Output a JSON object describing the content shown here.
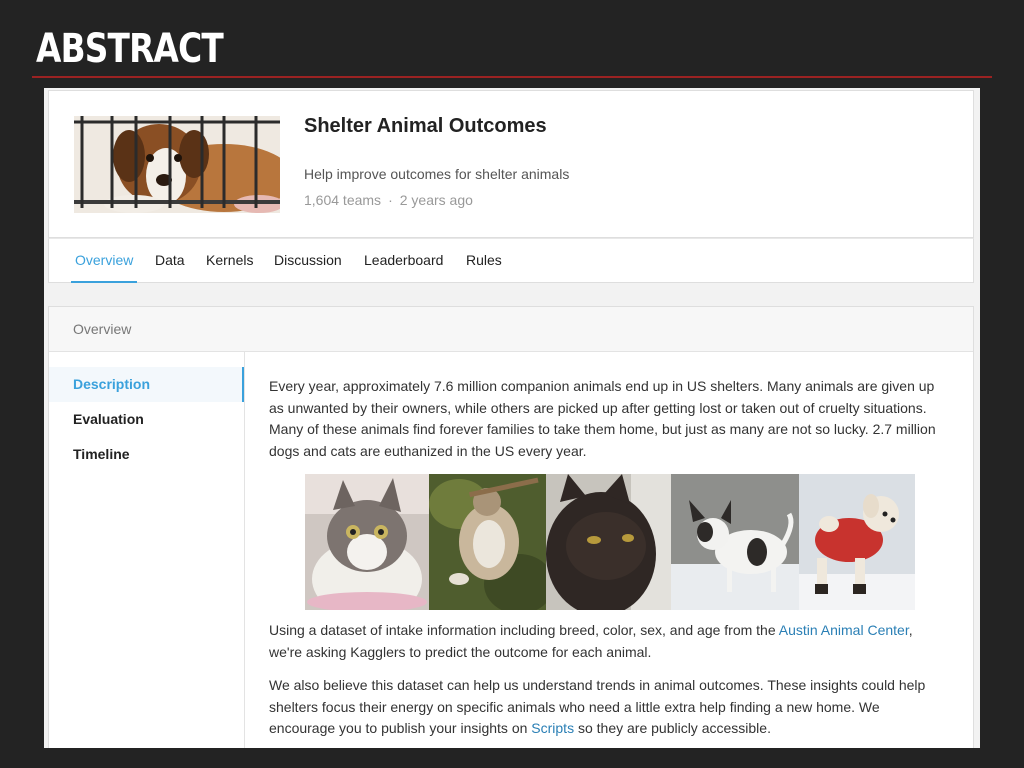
{
  "slide": {
    "title": "ABSTRACT"
  },
  "competition": {
    "title": "Shelter Animal Outcomes",
    "subtitle": "Help improve outcomes for shelter animals",
    "teams": "1,604 teams",
    "separator": "·",
    "age": "2 years ago"
  },
  "tabs": [
    {
      "label": "Overview",
      "active": true
    },
    {
      "label": "Data"
    },
    {
      "label": "Kernels"
    },
    {
      "label": "Discussion"
    },
    {
      "label": "Leaderboard"
    },
    {
      "label": "Rules"
    }
  ],
  "overview": {
    "header": "Overview",
    "nav": [
      {
        "label": "Description",
        "active": true
      },
      {
        "label": "Evaluation"
      },
      {
        "label": "Timeline"
      }
    ],
    "para1": "Every year, approximately 7.6 million companion animals end up in US shelters. Many animals are given up as unwanted by their owners, while others are picked up after getting lost or taken out of cruelty situations. Many of these animals find forever families to take them home, but just as many are not so lucky. 2.7 million dogs and cats are euthanized in the US every year.",
    "para2_before": "Using a dataset of intake information including breed, color, sex, and age from the ",
    "para2_link": "Austin Animal Center",
    "para2_after": ", we're asking Kagglers to predict the outcome for each animal.",
    "para3_before": "We also believe this dataset can help us understand trends in animal outcomes. These insights could help shelters focus their energy on specific animals who need a little extra help finding a new home. We encourage you to publish your insights on ",
    "para3_link": "Scripts",
    "para3_after": " so they are publicly accessible."
  },
  "colors": {
    "accent": "#3aa1dc",
    "link": "#2a7fb5",
    "slide_rule": "#9b2222",
    "slide_bg": "#232323"
  }
}
